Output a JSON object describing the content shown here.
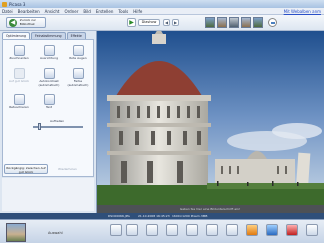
{
  "window": {
    "title": "Picasa 3"
  },
  "menu": {
    "items": [
      "Datei",
      "Bearbeiten",
      "Ansicht",
      "Ordner",
      "Bild",
      "Erstellen",
      "Tools",
      "Hilfe"
    ],
    "login": "Mit Webalben anm"
  },
  "toolbar": {
    "back_label": "Zurück zur Bibliothek",
    "play_icon": "play-icon",
    "slideshow_label": "Diashow"
  },
  "left_panel": {
    "tabs": [
      "Optimierung",
      "Feinabstimmung",
      "Effekte"
    ],
    "tools": [
      {
        "label": "Zuschneiden",
        "disabled": false
      },
      {
        "label": "Ausrichtung",
        "disabled": false
      },
      {
        "label": "Rote Augen",
        "disabled": false
      },
      {
        "label": "Auf gut Glück",
        "disabled": true
      },
      {
        "label": "Autokontrast (automatisch)",
        "disabled": false
      },
      {
        "label": "Farbe (automatisch)",
        "disabled": false
      },
      {
        "label": "Retuschieren",
        "disabled": false
      },
      {
        "label": "Text",
        "disabled": false
      }
    ],
    "fill_light_label": "Aufhellen",
    "fill_light_value": 0.12,
    "undo_label": "Rückgängig: zwischen Auf gut Glück",
    "redo_label": "Wiederholen"
  },
  "viewer": {
    "caption_placeholder": "Geben Sie hier eine Bildunterschrift ein!"
  },
  "status": {
    "filename": "DSC00066.JPG",
    "date": "21.10.2008 16:45:23",
    "dimensions": "1600×1200 Pixel",
    "size": "1.3MB"
  },
  "bottom": {
    "album_label": "Auswahl"
  }
}
